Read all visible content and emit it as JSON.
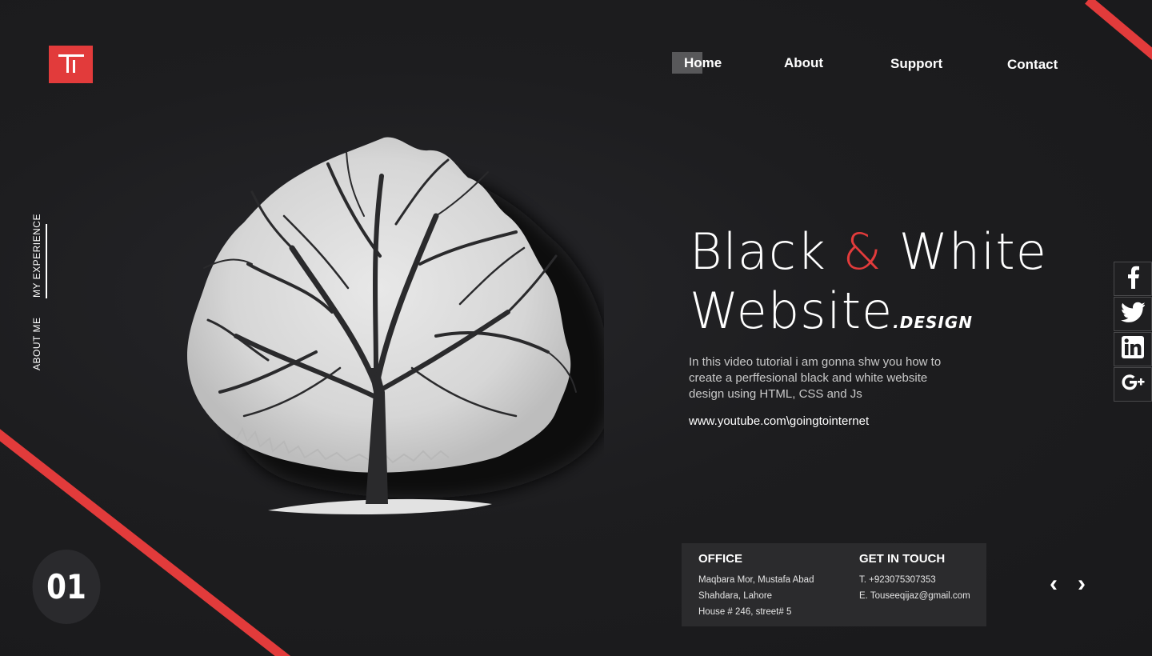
{
  "nav": {
    "items": [
      "Home",
      "About",
      "Support",
      "Contact"
    ],
    "active": "Home"
  },
  "side": {
    "experience": "MY EXPERIENCE",
    "about": "ABOUT ME"
  },
  "hero": {
    "title_black": "Black",
    "title_amp": "&",
    "title_white": "White",
    "title_website": "Website",
    "title_design": ".DESIGN",
    "description": "In this video tutorial i am gonna shw you how to create a perffesional black and white website design using HTML, CSS and Js",
    "link": "www.youtube.com\\goingtointernet"
  },
  "social": {
    "icons": [
      "facebook-icon",
      "twitter-icon",
      "linkedin-icon",
      "google-plus-icon"
    ]
  },
  "info": {
    "office_title": "OFFICE",
    "office_lines": [
      "Maqbara Mor, Mustafa Abad",
      "Shahdara, Lahore",
      "House # 246, street# 5"
    ],
    "contact_title": "GET IN TOUCH",
    "contact_lines": [
      "T. +923075307353",
      "E. Touseeqijaz@gmail.com"
    ]
  },
  "slider": {
    "prev": "‹",
    "next": "›",
    "counter": "01"
  },
  "colors": {
    "accent": "#e23b3b",
    "background": "#1c1c1e"
  }
}
